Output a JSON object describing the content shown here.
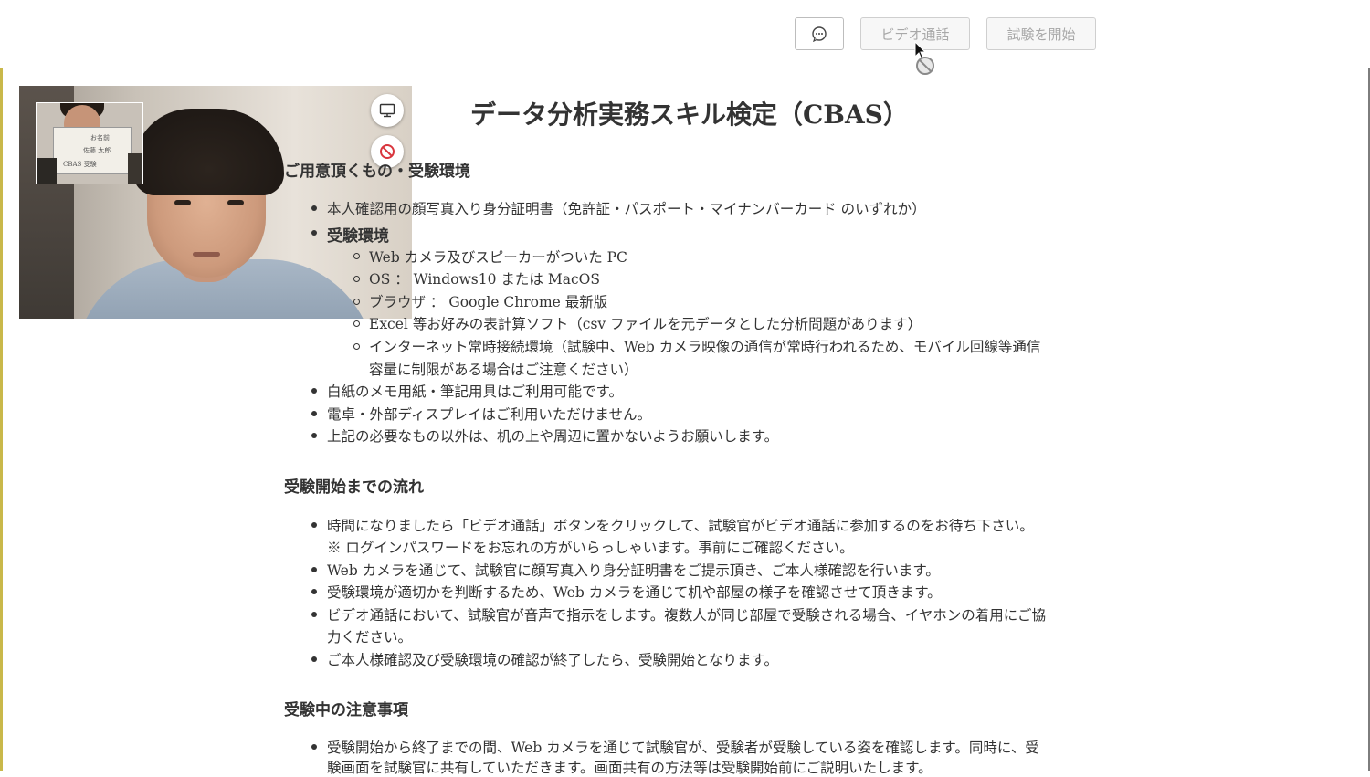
{
  "header": {
    "video_call_label": "ビデオ通話",
    "start_exam_label": "試験を開始"
  },
  "icons": {
    "chat": "chat-bubble-icon",
    "screen_share": "monitor-icon",
    "camera_off": "no-entry-icon",
    "cursor": "arrow-cursor-icon",
    "not_allowed": "not-allowed-icon"
  },
  "video": {
    "pip_card_line1": "お名前",
    "pip_card_line2": "佐藤 太郎",
    "pip_card_line3": "CBAS 受験"
  },
  "content": {
    "title": "データ分析実務スキル検定（CBAS）",
    "section1": {
      "heading": "ご用意頂くもの・受験環境",
      "item1": "本人確認用の顔写真入り身分証明書（免許証・パスポート・マイナンバーカード のいずれか）",
      "env_heading": "受験環境",
      "env_items": [
        "Web カメラ及びスピーカーがついた PC",
        "OS ： Windows10 または MacOS",
        "ブラウザ ： Google Chrome 最新版",
        "Excel 等お好みの表計算ソフト（csv ファイルを元データとした分析問題があります）",
        "インターネット常時接続環境（試験中、Web カメラ映像の通信が常時行われるため、モバイル回線等通信",
        "容量に制限がある場合はご注意ください）"
      ],
      "items": [
        "白紙のメモ用紙・筆記用具はご利用可能です。",
        "電卓・外部ディスプレイはご利用いただけません。",
        "上記の必要なもの以外は、机の上や周辺に置かないようお願いします。"
      ]
    },
    "section2": {
      "heading": "受験開始までの流れ",
      "lines": [
        "時間になりましたら「ビデオ通話」ボタンをクリックして、試験官がビデオ通話に参加するのをお待ち下さい。",
        "※ ログインパスワードをお忘れの方がいらっしゃいます。事前にご確認ください。",
        "Web カメラを通じて、試験官に顔写真入り身分証明書をご提示頂き、ご本人様確認を行います。",
        "受験環境が適切かを判断するため、Web カメラを通じて机や部屋の様子を確認させて頂きます。",
        "ビデオ通話において、試験官が音声で指示をします。複数人が同じ部屋で受験される場合、イヤホンの着用にご協",
        "力ください。",
        "ご本人様確認及び受験環境の確認が終了したら、受験開始となります。"
      ]
    },
    "section3": {
      "heading": "受験中の注意事項",
      "lines": [
        "受験開始から終了までの間、Web カメラを通じて試験官が、受験者が受験している姿を確認します。同時に、受",
        "験画面を試験官に共有していただきます。画面共有の方法等は受験開始前にご説明いたします。"
      ]
    }
  }
}
